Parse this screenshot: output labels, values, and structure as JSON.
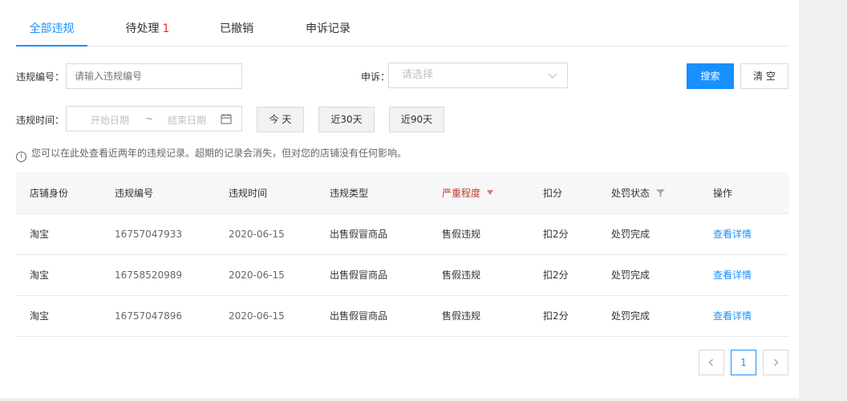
{
  "tabs": [
    {
      "label": "全部违规",
      "active": true
    },
    {
      "label": "待处理",
      "count": "1"
    },
    {
      "label": "已撤销"
    },
    {
      "label": "申诉记录"
    }
  ],
  "filters": {
    "violation_id_label": "违规编号：",
    "violation_id_placeholder": "请输入违规编号",
    "appeal_label": "申诉：",
    "appeal_placeholder": "请选择",
    "search_button": "搜索",
    "clear_button": "清 空",
    "time_label": "违规时间：",
    "start_placeholder": "开始日期",
    "range_sep": "~",
    "end_placeholder": "结束日期",
    "today_button": "今 天",
    "last30_button": "近30天",
    "last90_button": "近90天"
  },
  "notice": "您可以在此处查看近两年的违规记录。超期的记录会消失，但对您的店铺没有任何影响。",
  "table": {
    "headers": [
      "店铺身份",
      "违规编号",
      "违规时间",
      "违规类型",
      "严重程度",
      "扣分",
      "处罚状态",
      "操作"
    ],
    "rows": [
      [
        "淘宝",
        "16757047933",
        "2020-06-15",
        "出售假冒商品",
        "售假违规",
        "扣2分",
        "处罚完成",
        "查看详情"
      ],
      [
        "淘宝",
        "16758520989",
        "2020-06-15",
        "出售假冒商品",
        "售假违规",
        "扣2分",
        "处罚完成",
        "查看详情"
      ],
      [
        "淘宝",
        "16757047896",
        "2020-06-15",
        "出售假冒商品",
        "售假违规",
        "扣2分",
        "处罚完成",
        "查看详情"
      ]
    ]
  },
  "pagination": {
    "current": "1",
    "prev_icon": "chevron-left-icon",
    "next_icon": "chevron-right-icon"
  },
  "colors": {
    "accent": "#1890ff",
    "count_red": "#f5222d"
  }
}
